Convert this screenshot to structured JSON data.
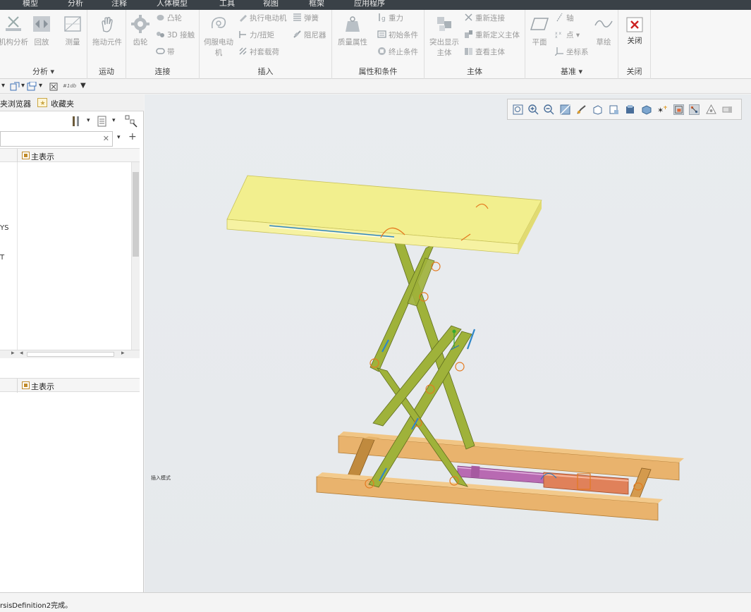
{
  "menu": {
    "tabs": [
      "模型",
      "分析",
      "注释",
      "人体模型",
      "工具",
      "视图",
      "框架",
      "应用程序"
    ]
  },
  "ribbon": {
    "groups": {
      "analysis": "分析",
      "motion": "运动",
      "connect": "连接",
      "insert": "插入",
      "properties": "属性和条件",
      "body": "主体",
      "datum": "基准",
      "close": "关闭"
    },
    "buttons": {
      "mechanism_analysis": "机构分析",
      "playback": "回放",
      "measure": "测量",
      "drag_components": "拖动元件",
      "gear": "齿轮",
      "cam": "凸轮",
      "contact_3d": "3D 接触",
      "belt": "带",
      "servo_motor_l1": "伺服电动",
      "servo_motor_l2": "机",
      "actuator_motor": "执行电动机",
      "force_torque": "力/扭矩",
      "bushing_load": "衬套载荷",
      "spring": "弹簧",
      "damper": "阻尼器",
      "mass_properties": "质量属性",
      "gravity": "重力",
      "initial_condition": "初始条件",
      "termination_condition": "终止条件",
      "highlight_body_l1": "突出显示",
      "highlight_body_l2": "主体",
      "reconnect": "重新连接",
      "redefine_body": "重新定义主体",
      "view_body": "查看主体",
      "plane": "平面",
      "axis": "轴",
      "point": "点",
      "csys": "坐标系",
      "sketch": "草绘",
      "close": "关闭"
    }
  },
  "qat": {
    "label": "#1db"
  },
  "left_panel": {
    "tabs": {
      "browser": "夹浏览器",
      "favorites": "收藏夹"
    },
    "column_header": "主表示",
    "tree_fragments": [
      "YS",
      "T"
    ]
  },
  "graphics": {
    "small_label": "插入模式"
  },
  "statusbar": {
    "message": "rsisDefinition2完成。"
  },
  "colors": {
    "menubar": "#3a4147",
    "platform_top": "#f2ef8e",
    "scissor_arm": "#9fb23a",
    "base_frame": "#e3a65a",
    "cylinder_body": "#e0815a",
    "cylinder_rod": "#b86ab2",
    "close_icon": "#cc2222"
  }
}
